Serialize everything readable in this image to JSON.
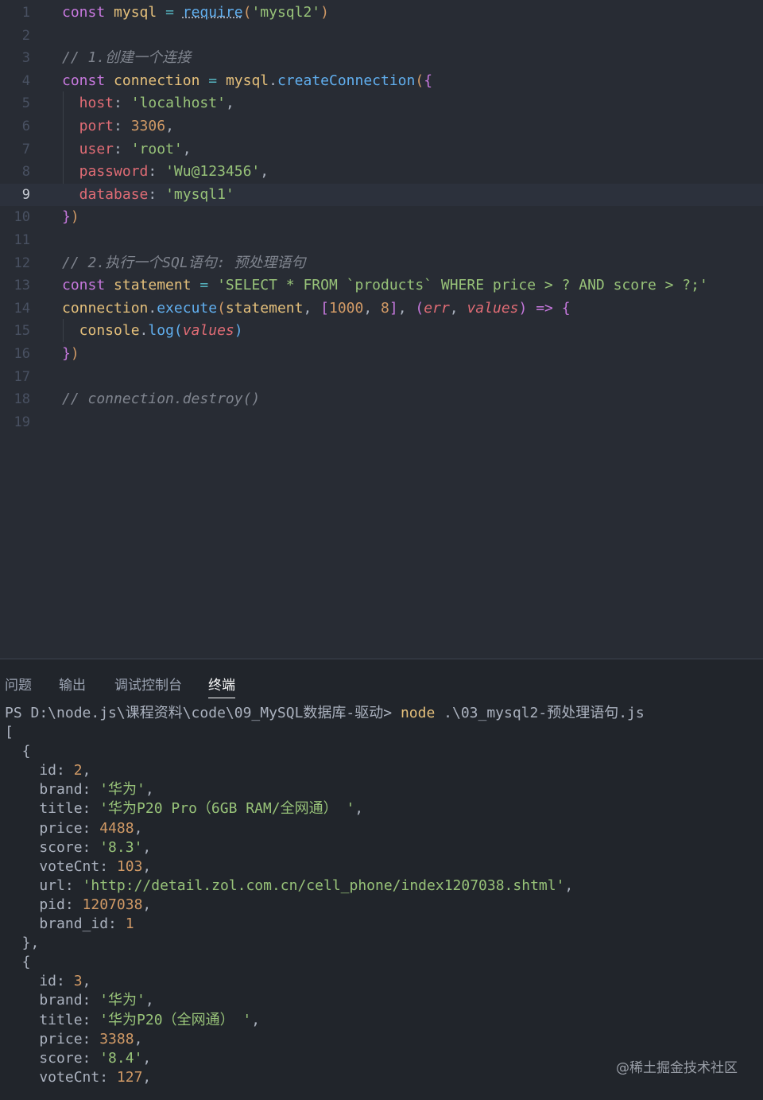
{
  "editor": {
    "active_line": 9,
    "lines": [
      {
        "n": "1",
        "tokens": [
          {
            "t": "const ",
            "c": "kw"
          },
          {
            "t": "mysql ",
            "c": "var"
          },
          {
            "t": "= ",
            "c": "op"
          },
          {
            "t": "require",
            "c": "fn req"
          },
          {
            "t": "(",
            "c": "br1"
          },
          {
            "t": "'mysql2'",
            "c": "str"
          },
          {
            "t": ")",
            "c": "br1"
          }
        ]
      },
      {
        "n": "2",
        "tokens": []
      },
      {
        "n": "3",
        "tokens": [
          {
            "t": "// 1.创建一个连接",
            "c": "cm"
          }
        ]
      },
      {
        "n": "4",
        "tokens": [
          {
            "t": "const ",
            "c": "kw"
          },
          {
            "t": "connection ",
            "c": "var"
          },
          {
            "t": "= ",
            "c": "op"
          },
          {
            "t": "mysql",
            "c": "var"
          },
          {
            "t": ".",
            "c": ""
          },
          {
            "t": "createConnection",
            "c": "fn"
          },
          {
            "t": "(",
            "c": "br1"
          },
          {
            "t": "{",
            "c": "br2"
          }
        ]
      },
      {
        "n": "5",
        "tokens": [
          {
            "t": "  host",
            "c": "prop"
          },
          {
            "t": ": ",
            "c": ""
          },
          {
            "t": "'localhost'",
            "c": "str"
          },
          {
            "t": ",",
            "c": ""
          }
        ]
      },
      {
        "n": "6",
        "tokens": [
          {
            "t": "  port",
            "c": "prop"
          },
          {
            "t": ": ",
            "c": ""
          },
          {
            "t": "3306",
            "c": "num"
          },
          {
            "t": ",",
            "c": ""
          }
        ]
      },
      {
        "n": "7",
        "tokens": [
          {
            "t": "  user",
            "c": "prop"
          },
          {
            "t": ": ",
            "c": ""
          },
          {
            "t": "'root'",
            "c": "str"
          },
          {
            "t": ",",
            "c": ""
          }
        ]
      },
      {
        "n": "8",
        "tokens": [
          {
            "t": "  password",
            "c": "prop"
          },
          {
            "t": ": ",
            "c": ""
          },
          {
            "t": "'Wu@123456'",
            "c": "str"
          },
          {
            "t": ",",
            "c": ""
          }
        ]
      },
      {
        "n": "9",
        "tokens": [
          {
            "t": "  database",
            "c": "prop"
          },
          {
            "t": ": ",
            "c": ""
          },
          {
            "t": "'mysql1'",
            "c": "str"
          }
        ]
      },
      {
        "n": "10",
        "tokens": [
          {
            "t": "}",
            "c": "br2"
          },
          {
            "t": ")",
            "c": "br1"
          }
        ]
      },
      {
        "n": "11",
        "tokens": []
      },
      {
        "n": "12",
        "tokens": [
          {
            "t": "// 2.执行一个SQL语句: 预处理语句",
            "c": "cm"
          }
        ]
      },
      {
        "n": "13",
        "tokens": [
          {
            "t": "const ",
            "c": "kw"
          },
          {
            "t": "statement ",
            "c": "var"
          },
          {
            "t": "= ",
            "c": "op"
          },
          {
            "t": "'SELECT * FROM `products` WHERE price > ? AND score > ?;'",
            "c": "str"
          }
        ]
      },
      {
        "n": "14",
        "tokens": [
          {
            "t": "connection",
            "c": "var"
          },
          {
            "t": ".",
            "c": ""
          },
          {
            "t": "execute",
            "c": "fn"
          },
          {
            "t": "(",
            "c": "br1"
          },
          {
            "t": "statement",
            "c": "var"
          },
          {
            "t": ", ",
            "c": ""
          },
          {
            "t": "[",
            "c": "br2"
          },
          {
            "t": "1000",
            "c": "num"
          },
          {
            "t": ", ",
            "c": ""
          },
          {
            "t": "8",
            "c": "num"
          },
          {
            "t": "]",
            "c": "br2"
          },
          {
            "t": ", ",
            "c": ""
          },
          {
            "t": "(",
            "c": "br2"
          },
          {
            "t": "err",
            "c": "it"
          },
          {
            "t": ", ",
            "c": ""
          },
          {
            "t": "values",
            "c": "it"
          },
          {
            "t": ") ",
            "c": "br2"
          },
          {
            "t": "=> ",
            "c": "kw"
          },
          {
            "t": "{",
            "c": "br2"
          }
        ]
      },
      {
        "n": "15",
        "tokens": [
          {
            "t": "  console",
            "c": "var"
          },
          {
            "t": ".",
            "c": ""
          },
          {
            "t": "log",
            "c": "fn"
          },
          {
            "t": "(",
            "c": "br3"
          },
          {
            "t": "values",
            "c": "it"
          },
          {
            "t": ")",
            "c": "br3"
          }
        ]
      },
      {
        "n": "16",
        "tokens": [
          {
            "t": "}",
            "c": "br2"
          },
          {
            "t": ")",
            "c": "br1"
          }
        ]
      },
      {
        "n": "17",
        "tokens": []
      },
      {
        "n": "18",
        "tokens": [
          {
            "t": "// connection.destroy()",
            "c": "cm"
          }
        ]
      },
      {
        "n": "19",
        "tokens": []
      }
    ]
  },
  "panel": {
    "tabs": [
      "问题",
      "输出",
      "调试控制台",
      "终端"
    ],
    "active_tab": "终端"
  },
  "terminal": {
    "lines": [
      [
        {
          "t": "PS D:\\node.js\\课程资料\\code\\09_MySQL数据库-驱动> ",
          "c": ""
        },
        {
          "t": "node",
          "c": "cmd"
        },
        {
          "t": " .\\03_mysql2-预处理语句.js",
          "c": ""
        }
      ],
      [
        {
          "t": "[",
          "c": ""
        }
      ],
      [
        {
          "t": "  {",
          "c": ""
        }
      ],
      [
        {
          "t": "    id: ",
          "c": ""
        },
        {
          "t": "2",
          "c": "num"
        },
        {
          "t": ",",
          "c": ""
        }
      ],
      [
        {
          "t": "    brand: ",
          "c": ""
        },
        {
          "t": "'华为'",
          "c": "str"
        },
        {
          "t": ",",
          "c": ""
        }
      ],
      [
        {
          "t": "    title: ",
          "c": ""
        },
        {
          "t": "'华为P20 Pro（6GB RAM/全网通） '",
          "c": "str"
        },
        {
          "t": ",",
          "c": ""
        }
      ],
      [
        {
          "t": "    price: ",
          "c": ""
        },
        {
          "t": "4488",
          "c": "num"
        },
        {
          "t": ",",
          "c": ""
        }
      ],
      [
        {
          "t": "    score: ",
          "c": ""
        },
        {
          "t": "'8.3'",
          "c": "str"
        },
        {
          "t": ",",
          "c": ""
        }
      ],
      [
        {
          "t": "    voteCnt: ",
          "c": ""
        },
        {
          "t": "103",
          "c": "num"
        },
        {
          "t": ",",
          "c": ""
        }
      ],
      [
        {
          "t": "    url: ",
          "c": ""
        },
        {
          "t": "'http://detail.zol.com.cn/cell_phone/index1207038.shtml'",
          "c": "str"
        },
        {
          "t": ",",
          "c": ""
        }
      ],
      [
        {
          "t": "    pid: ",
          "c": ""
        },
        {
          "t": "1207038",
          "c": "num"
        },
        {
          "t": ",",
          "c": ""
        }
      ],
      [
        {
          "t": "    brand_id: ",
          "c": ""
        },
        {
          "t": "1",
          "c": "num"
        }
      ],
      [
        {
          "t": "  },",
          "c": ""
        }
      ],
      [
        {
          "t": "  {",
          "c": ""
        }
      ],
      [
        {
          "t": "    id: ",
          "c": ""
        },
        {
          "t": "3",
          "c": "num"
        },
        {
          "t": ",",
          "c": ""
        }
      ],
      [
        {
          "t": "    brand: ",
          "c": ""
        },
        {
          "t": "'华为'",
          "c": "str"
        },
        {
          "t": ",",
          "c": ""
        }
      ],
      [
        {
          "t": "    title: ",
          "c": ""
        },
        {
          "t": "'华为P20（全网通） '",
          "c": "str"
        },
        {
          "t": ",",
          "c": ""
        }
      ],
      [
        {
          "t": "    price: ",
          "c": ""
        },
        {
          "t": "3388",
          "c": "num"
        },
        {
          "t": ",",
          "c": ""
        }
      ],
      [
        {
          "t": "    score: ",
          "c": ""
        },
        {
          "t": "'8.4'",
          "c": "str"
        },
        {
          "t": ",",
          "c": ""
        }
      ],
      [
        {
          "t": "    voteCnt: ",
          "c": ""
        },
        {
          "t": "127",
          "c": "num"
        },
        {
          "t": ",",
          "c": ""
        }
      ]
    ]
  },
  "watermark": "@稀土掘金技术社区"
}
